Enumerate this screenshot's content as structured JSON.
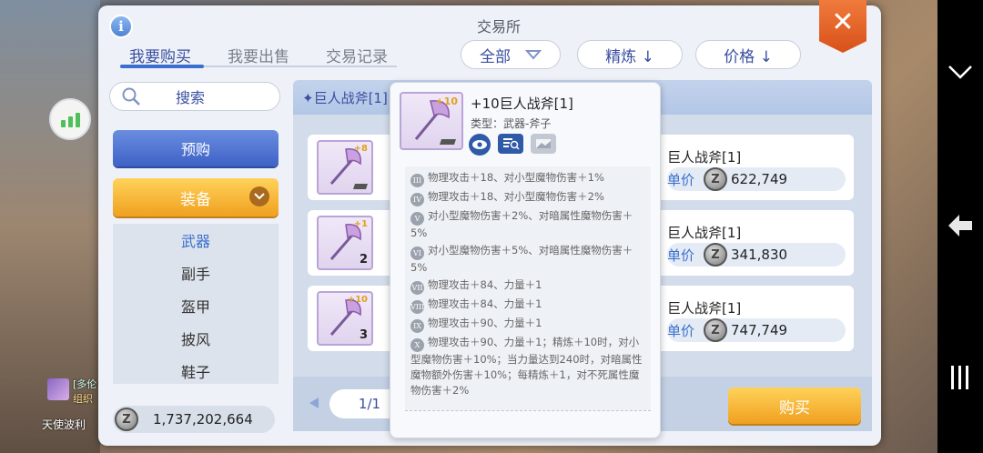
{
  "modal": {
    "title": "交易所",
    "close_label": "✕",
    "info_label": "i"
  },
  "tabs": [
    {
      "label": "我要购买",
      "active": true
    },
    {
      "label": "我要出售",
      "active": false
    },
    {
      "label": "交易记录",
      "active": false
    }
  ],
  "filters": {
    "category": "全部",
    "refine_sort": "精炼 ↓",
    "price_sort": "价格 ↓"
  },
  "search": {
    "label": "搜索"
  },
  "sidebar": {
    "preorder_label": "预购",
    "equipment_label": "装备",
    "categories": [
      {
        "label": "武器",
        "active": true
      },
      {
        "label": "副手",
        "active": false
      },
      {
        "label": "盔甲",
        "active": false
      },
      {
        "label": "披风",
        "active": false
      },
      {
        "label": "鞋子",
        "active": false
      }
    ]
  },
  "wallet": {
    "balance": "1,737,202,664",
    "currency_icon": "Z"
  },
  "list": {
    "header": "✦巨人战斧[1]",
    "price_label": "单价",
    "items": [
      {
        "name": "巨人战斧[1]",
        "price": "622,749",
        "refine": "+8",
        "count": ""
      },
      {
        "name": "巨人战斧[1]",
        "price": "341,830",
        "refine": "+1",
        "count": "2"
      },
      {
        "name": "巨人战斧[1]",
        "price": "747,749",
        "refine": "+10",
        "count": "3"
      }
    ]
  },
  "pagination": {
    "page": "1/1"
  },
  "buy_button": "购买",
  "tooltip": {
    "name": "+10巨人战斧[1]",
    "refine": "+10",
    "type_label": "类型：武器-斧子",
    "enchant_lines": [
      {
        "rank": "III",
        "text": "物理攻击＋18、对小型魔物伤害＋1%"
      },
      {
        "rank": "IV",
        "text": "物理攻击＋18、对小型魔物伤害＋2%"
      },
      {
        "rank": "V",
        "text": "对小型魔物伤害＋2%、对暗属性魔物伤害＋5%"
      },
      {
        "rank": "VI",
        "text": "对小型魔物伤害＋5%、对暗属性魔物伤害＋5%"
      },
      {
        "rank": "VII",
        "text": "物理攻击＋84、力量＋1"
      },
      {
        "rank": "VIII",
        "text": "物理攻击＋84、力量＋1"
      },
      {
        "rank": "IX",
        "text": "物理攻击＋90、力量＋1"
      },
      {
        "rank": "X",
        "text": "物理攻击＋90、力量＋1；精炼＋10时，对小型魔物伤害＋10%；当力量达到240时，对暗属性魔物额外伤害＋10%；每精炼＋1，对不死属性魔物伤害＋2%"
      }
    ]
  },
  "background": {
    "chat_lines": [
      "[多伦]",
      "组织",
      "天使波利"
    ]
  },
  "colors": {
    "accent_blue": "#3a6fcf",
    "close_orange": "#e8601f",
    "buy_orange": "#f0a020"
  }
}
